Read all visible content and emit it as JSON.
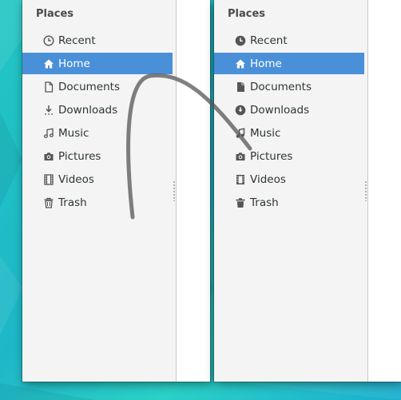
{
  "sidebar_left": {
    "heading": "Places",
    "icon_style": "outline",
    "items": [
      {
        "label": "Recent",
        "icon": "clock-icon"
      },
      {
        "label": "Home",
        "icon": "home-icon",
        "selected": true
      },
      {
        "label": "Documents",
        "icon": "document-icon"
      },
      {
        "label": "Downloads",
        "icon": "download-icon"
      },
      {
        "label": "Music",
        "icon": "music-note-icon"
      },
      {
        "label": "Pictures",
        "icon": "camera-icon"
      },
      {
        "label": "Videos",
        "icon": "film-icon"
      },
      {
        "label": "Trash",
        "icon": "trash-icon"
      }
    ]
  },
  "sidebar_right": {
    "heading": "Places",
    "icon_style": "filled",
    "items": [
      {
        "label": "Recent",
        "icon": "clock-icon"
      },
      {
        "label": "Home",
        "icon": "home-icon",
        "selected": true
      },
      {
        "label": "Documents",
        "icon": "document-icon"
      },
      {
        "label": "Downloads",
        "icon": "download-icon"
      },
      {
        "label": "Music",
        "icon": "music-note-icon"
      },
      {
        "label": "Pictures",
        "icon": "camera-icon"
      },
      {
        "label": "Videos",
        "icon": "film-icon"
      },
      {
        "label": "Trash",
        "icon": "trash-icon"
      }
    ]
  },
  "colors": {
    "selection": "#4a90d9",
    "sidebar_bg": "#f4f4f4",
    "desktop": "#22c7c3",
    "gesture_arrow": "#555555"
  }
}
